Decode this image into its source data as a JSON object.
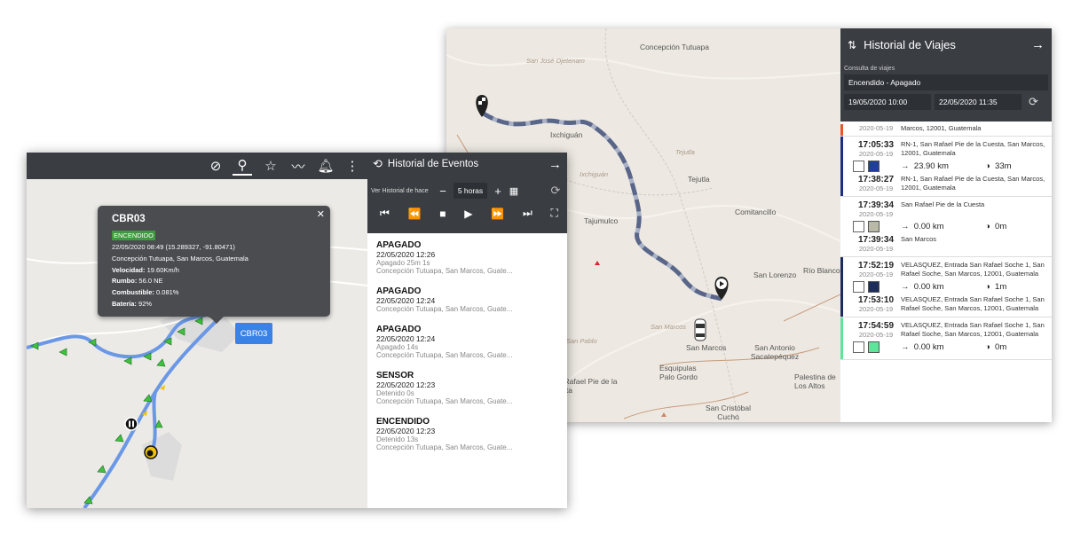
{
  "trip_history": {
    "title": "Historial de Viajes",
    "query_label": "Consulta de viajes",
    "mode": "Encendido - Apagado",
    "date_from": "19/05/2020 10:00",
    "date_to": "22/05/2020 11:35",
    "top_partial_date": "2020-05-19",
    "top_partial_addr": "Marcos, 12001, Guatemala",
    "trips": [
      {
        "bar_color": "#1f2f80",
        "start_time": "17:05:33",
        "start_date": "2020-05-19",
        "start_addr": "RN-1, San Rafael Pie de la Cuesta, San Marcos, 12001, Guatemala",
        "swatch": "#1f3f9a",
        "distance": "23.90 km",
        "duration": "33m",
        "end_time": "17:38:27",
        "end_date": "2020-05-19",
        "end_addr": "RN-1, San Rafael Pie de la Cuesta, San Marcos, 12001, Guatemala"
      },
      {
        "bar_color": "#ffffff",
        "start_time": "17:39:34",
        "start_date": "2020-05-19",
        "start_addr": "San Rafael Pie de la Cuesta",
        "swatch": "#b9b9a8",
        "distance": "0.00 km",
        "duration": "0m",
        "end_time": "17:39:34",
        "end_date": "2020-05-19",
        "end_addr": "San Marcos"
      },
      {
        "bar_color": "#1d2a60",
        "start_time": "17:52:19",
        "start_date": "2020-05-19",
        "start_addr": "VELASQUEZ, Entrada San Rafael Soche 1, San Rafael Soche, San Marcos, 12001, Guatemala",
        "swatch": "#1d2d5a",
        "distance": "0.00 km",
        "duration": "1m",
        "end_time": "17:53:10",
        "end_date": "2020-05-19",
        "end_addr": "VELASQUEZ, Entrada San Rafael Soche 1, San Rafael Soche, San Marcos, 12001, Guatemala"
      },
      {
        "bar_color": "#5de69a",
        "start_time": "17:54:59",
        "start_date": "2020-05-19",
        "start_addr": "VELASQUEZ, Entrada San Rafael Soche 1, San Rafael Soche, San Marcos, 12001, Guatemala",
        "swatch": "#5de69a",
        "distance": "0.00 km",
        "duration": "0m",
        "end_time": "",
        "end_date": "",
        "end_addr": ""
      }
    ]
  },
  "back_map": {
    "labels": [
      "Concepción Tutuapa",
      "San José Ojetenam",
      "Ixchiguán",
      "Ixchiguán",
      "Tejutla",
      "Tejutla",
      "Comitancillo",
      "Tajumulco",
      "Río Blanco",
      "San Lorenzo",
      "San Marcos",
      "San Marcos",
      "San Antonio Sacatepéquez",
      "San Rafael Pie de la Cuesta",
      "Esquipulas Palo Gordo",
      "San Cristóbal Cucho",
      "Palestina de Los Altos",
      "San Pablo"
    ],
    "vehicle_label": "CBR03"
  },
  "events": {
    "title": "Historial de Eventos",
    "range_label": "Ver Historial de hace",
    "range_value": "5 horas",
    "items": [
      {
        "type": "APAGADO",
        "date": "22/05/2020 12:26",
        "note": "Apagado 25m 1s",
        "addr": "Concepción Tutuapa, San Marcos, Guate..."
      },
      {
        "type": "APAGADO",
        "date": "22/05/2020 12:24",
        "note": "",
        "addr": "Concepción Tutuapa, San Marcos, Guate..."
      },
      {
        "type": "APAGADO",
        "date": "22/05/2020 12:24",
        "note": "Apagado 14s",
        "addr": "Concepción Tutuapa, San Marcos, Guate..."
      },
      {
        "type": "SENSOR",
        "date": "22/05/2020 12:23",
        "note": "Detenido 0s",
        "addr": "Concepción Tutuapa, San Marcos, Guate..."
      },
      {
        "type": "ENCENDIDO",
        "date": "22/05/2020 12:23",
        "note": "Detenido 13s",
        "addr": "Concepción Tutuapa, San Marcos, Guate..."
      }
    ]
  },
  "popup": {
    "title": "CBR03",
    "status": "ENCENDIDO",
    "line1": "22/05/2020 08:49 (15.289327, -91.80471)",
    "line2": "Concepción Tutuapa, San Marcos, Guatemala",
    "speed_label": "Velocidad:",
    "speed": "19.60Km/h",
    "heading_label": "Rumbo:",
    "heading": "56.0 NE",
    "fuel_label": "Combustible:",
    "fuel": "0.081%",
    "battery_label": "Batería:",
    "battery": "92%"
  },
  "icons": {
    "toolbar": [
      "satellite-off-icon",
      "pin-off-icon",
      "star-outline-icon",
      "chart-line-icon",
      "bell-icon",
      "kebab-menu-icon"
    ],
    "playback": [
      "skip-start-icon",
      "rewind-icon",
      "stop-icon",
      "play-icon",
      "fast-forward-icon",
      "skip-end-icon",
      "fit-screen-icon"
    ]
  }
}
